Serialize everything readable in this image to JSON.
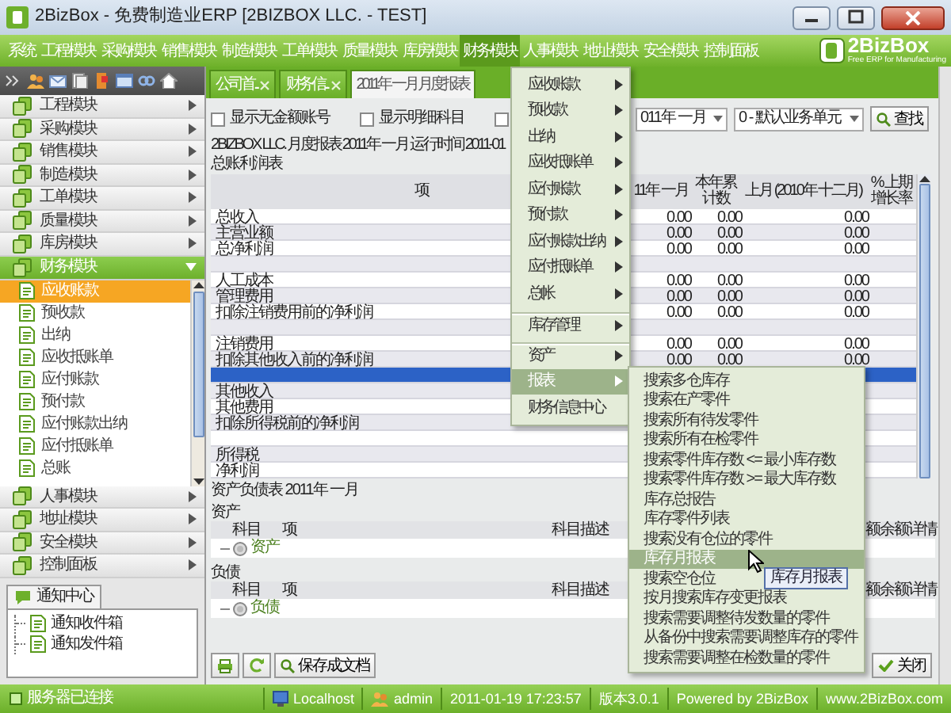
{
  "window": {
    "title": "2BizBox - 免费制造业ERP [2BIZBOX LLC. - TEST]"
  },
  "menu_bar": [
    {
      "label": "系统",
      "selected": false
    },
    {
      "label": "工程模块",
      "selected": false
    },
    {
      "label": "采购模块",
      "selected": false
    },
    {
      "label": "销售模块",
      "selected": false
    },
    {
      "label": "制造模块",
      "selected": false
    },
    {
      "label": "工单模块",
      "selected": false
    },
    {
      "label": "质量模块",
      "selected": false
    },
    {
      "label": "库房模块",
      "selected": false
    },
    {
      "label": "财务模块",
      "selected": true
    },
    {
      "label": "人事模块",
      "selected": false
    },
    {
      "label": "地址模块",
      "selected": false
    },
    {
      "label": "安全模块",
      "selected": false
    },
    {
      "label": "控制面板",
      "selected": false
    }
  ],
  "logo": {
    "name": "2BizBox",
    "tagline": "Free ERP for Manufacturing"
  },
  "sidebar": {
    "modules": [
      {
        "label": "工程模块",
        "expanded": false
      },
      {
        "label": "采购模块",
        "expanded": false
      },
      {
        "label": "销售模块",
        "expanded": false
      },
      {
        "label": "制造模块",
        "expanded": false
      },
      {
        "label": "工单模块",
        "expanded": false
      },
      {
        "label": "质量模块",
        "expanded": false
      },
      {
        "label": "库房模块",
        "expanded": false
      },
      {
        "label": "财务模块",
        "expanded": true,
        "children": [
          {
            "label": "应收账款",
            "selected": true
          },
          {
            "label": "预收款",
            "selected": false
          },
          {
            "label": "出纳",
            "selected": false
          },
          {
            "label": "应收抵账单",
            "selected": false
          },
          {
            "label": "应付账款",
            "selected": false
          },
          {
            "label": "预付款",
            "selected": false
          },
          {
            "label": "应付账款出纳",
            "selected": false
          },
          {
            "label": "应付抵账单",
            "selected": false
          },
          {
            "label": "总账",
            "selected": false
          }
        ]
      },
      {
        "label": "人事模块",
        "expanded": false
      },
      {
        "label": "地址模块",
        "expanded": false
      },
      {
        "label": "安全模块",
        "expanded": false
      },
      {
        "label": "控制面板",
        "expanded": false
      }
    ]
  },
  "notification_center": {
    "tab": "通知中心",
    "items": [
      "通知收件箱",
      "通知发件箱"
    ]
  },
  "tabs": [
    {
      "label": "公司首...",
      "selected": false
    },
    {
      "label": "财务信...",
      "selected": false
    },
    {
      "label": "2011年 一月 月度报表",
      "selected": true
    }
  ],
  "filters": {
    "checkboxes": [
      {
        "label": "显示无金额账号",
        "checked": false
      },
      {
        "label": "显示明细科目",
        "checked": false
      },
      {
        "checked": false
      }
    ],
    "period_select": "011年 一月",
    "unit_select": "0 - 默认业务单元",
    "search_button": "查找"
  },
  "report_title": "2BIZBOX LLC. 月度报表 2011年 一月 运行时间 2011-01",
  "income_statement": {
    "title": "总账利润表",
    "columns": [
      "项",
      "11年 一月",
      "本年累计数",
      "上月 (2010年 十二月)",
      "% 上期增长率"
    ],
    "rows": [
      {
        "label": "总收入",
        "values": [
          "0.00",
          "0.00",
          "0.00"
        ],
        "selected": false
      },
      {
        "label": "主营业额",
        "values": [
          "0.00",
          "0.00",
          "0.00"
        ],
        "selected": false
      },
      {
        "label": "总净利润",
        "values": [
          "0.00",
          "0.00",
          "0.00"
        ],
        "selected": false
      },
      {
        "selected": false
      },
      {
        "label": "人工成本",
        "values": [
          "0.00",
          "0.00",
          "0.00"
        ],
        "selected": false
      },
      {
        "label": "管理费用",
        "values": [
          "0.00",
          "0.00",
          "0.00"
        ],
        "selected": false
      },
      {
        "label": "扣除注销费用前的净利润",
        "values": [
          "0.00",
          "0.00",
          "0.00"
        ],
        "selected": false
      },
      {
        "selected": false
      },
      {
        "label": "注销费用",
        "values": [
          "0.00",
          "0.00",
          "0.00"
        ],
        "selected": false
      },
      {
        "label": "扣除其他收入前的净利润",
        "values": [
          "0.00",
          "0.00",
          "0.00"
        ],
        "selected": false
      },
      {
        "selected": true
      },
      {
        "label": "其他收入",
        "selected": false
      },
      {
        "label": "其他费用",
        "selected": false
      },
      {
        "label": "扣除所得税前的净利润",
        "selected": false
      },
      {
        "selected": false
      },
      {
        "label": "所得税",
        "selected": false
      },
      {
        "label": "净利润",
        "selected": false
      }
    ]
  },
  "balance_sheet": {
    "title": "资产负债表 2011年 一月",
    "sections": [
      {
        "heading": "资产",
        "columns": [
          "科目",
          "项",
          "科目描述",
          "额余额",
          "详情"
        ],
        "rows": [
          "资产"
        ]
      },
      {
        "heading": "负债",
        "columns": [
          "科目",
          "项",
          "科目描述",
          "额余额",
          "详情"
        ],
        "rows": [
          "负债"
        ]
      }
    ]
  },
  "bottom_toolbar": {
    "save_button": "保存成文档",
    "close_button": "关闭"
  },
  "finance_menu": [
    {
      "label": "应收账款",
      "has_submenu": true,
      "divider_before": false,
      "selected": false
    },
    {
      "label": "预收款",
      "has_submenu": true,
      "divider_before": false,
      "selected": false
    },
    {
      "label": "出纳",
      "has_submenu": true,
      "divider_before": false,
      "selected": false
    },
    {
      "label": "应收抵账单",
      "has_submenu": true,
      "divider_before": false,
      "selected": false
    },
    {
      "label": "应付账款",
      "has_submenu": true,
      "divider_before": false,
      "selected": false
    },
    {
      "label": "预付款",
      "has_submenu": true,
      "divider_before": false,
      "selected": false
    },
    {
      "label": "应付账款出纳",
      "has_submenu": true,
      "divider_before": false,
      "selected": false
    },
    {
      "label": "应付抵账单",
      "has_submenu": true,
      "divider_before": false,
      "selected": false
    },
    {
      "label": "总帐",
      "has_submenu": true,
      "divider_before": false,
      "selected": false
    },
    {
      "label": "库存管理",
      "has_submenu": true,
      "divider_before": true,
      "selected": false
    },
    {
      "label": "资产",
      "has_submenu": true,
      "divider_before": true,
      "selected": false
    },
    {
      "label": "报表",
      "has_submenu": true,
      "divider_before": false,
      "selected": true
    },
    {
      "label": "财务信息中心",
      "has_submenu": false,
      "divider_before": false,
      "selected": false
    }
  ],
  "report_submenu": [
    {
      "label": "搜索多仓库存",
      "selected": false
    },
    {
      "label": "搜索在产零件",
      "selected": false
    },
    {
      "label": "搜索所有待发零件",
      "selected": false
    },
    {
      "label": "搜索所有在检零件",
      "selected": false
    },
    {
      "label": "搜索零件库存数 <= 最小库存数",
      "selected": false
    },
    {
      "label": "搜索零件库存数 >= 最大库存数",
      "selected": false
    },
    {
      "label": "库存总报告",
      "selected": false
    },
    {
      "label": "库存零件列表",
      "selected": false
    },
    {
      "label": "搜索没有仓位的零件",
      "selected": false
    },
    {
      "label": "库存月报表",
      "selected": true
    },
    {
      "label": "搜索空仓位",
      "selected": false
    },
    {
      "label": "按月搜索库存变更报表",
      "selected": false
    },
    {
      "label": "搜索需要调整待发数量的零件",
      "selected": false
    },
    {
      "label": "从备份中搜索需要调整库存的零件",
      "selected": false
    },
    {
      "label": "搜索需要调整在检数量的零件",
      "selected": false
    }
  ],
  "tooltip": "库存月报表",
  "status_bar": {
    "connection": "服务器已连接",
    "host": "Localhost",
    "user": "admin",
    "datetime": "2011-01-19 17:23:57",
    "version": "版本3.0.1",
    "powered_by": "Powered by 2BizBox",
    "website": "www.2BizBox.com"
  }
}
